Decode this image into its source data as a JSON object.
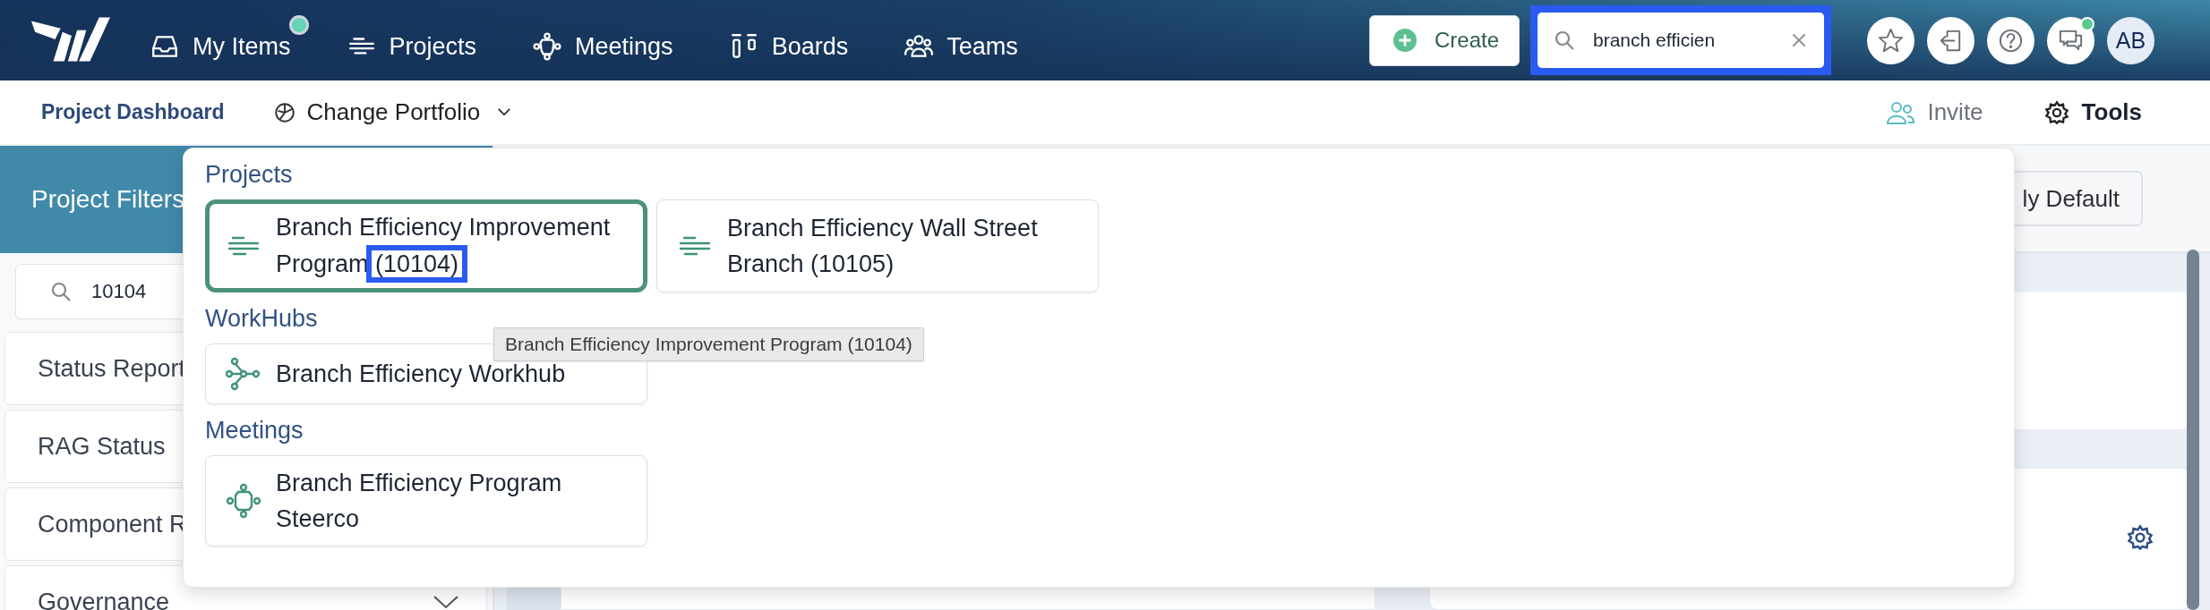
{
  "nav": {
    "items": [
      {
        "label": "My Items",
        "kind": "inbox",
        "badge": true
      },
      {
        "label": "Projects",
        "kind": "projects",
        "badge": false
      },
      {
        "label": "Meetings",
        "kind": "meetings",
        "badge": false
      },
      {
        "label": "Boards",
        "kind": "boards",
        "badge": false
      },
      {
        "label": "Teams",
        "kind": "teams",
        "badge": false
      }
    ],
    "create_button": "Create",
    "search": {
      "value": "branch efficien",
      "highlighted": true
    },
    "icon_buttons": [
      {
        "kind": "star",
        "badge": false
      },
      {
        "kind": "exit",
        "badge": false
      },
      {
        "kind": "help",
        "badge": false
      },
      {
        "kind": "chat",
        "badge": true
      }
    ],
    "avatar": "AB"
  },
  "subbar": {
    "title": "Project Dashboard",
    "portfolio": "Change Portfolio",
    "invite": "Invite",
    "tools": "Tools"
  },
  "filters": {
    "title": "Project Filters",
    "search": "10104",
    "items": [
      {
        "label": "Status Report",
        "kind": "plain"
      },
      {
        "label": "RAG Status",
        "kind": "plain"
      },
      {
        "label": "Component R",
        "kind": "plain"
      },
      {
        "label": "Governance",
        "kind": "collapsible"
      }
    ]
  },
  "default_button": "ly Default",
  "search_results": {
    "sections": [
      {
        "title": "Projects",
        "kind": "project",
        "items": [
          {
            "name": "Branch Efficiency Improvement Program",
            "code": "(10104)",
            "selected": true,
            "highlighted": true
          },
          {
            "name": "Branch Efficiency Wall Street Branch",
            "code": "(10105)",
            "selected": false,
            "highlighted": false
          }
        ]
      },
      {
        "title": "WorkHubs",
        "kind": "workhub",
        "items": [
          {
            "name": "Branch Efficiency Workhub",
            "selected": false
          }
        ]
      },
      {
        "title": "Meetings",
        "kind": "meeting",
        "items": [
          {
            "name": "Branch Efficiency Program Steerco",
            "selected": false
          }
        ]
      }
    ],
    "tooltip": "Branch Efficiency Improvement Program (10104)"
  }
}
